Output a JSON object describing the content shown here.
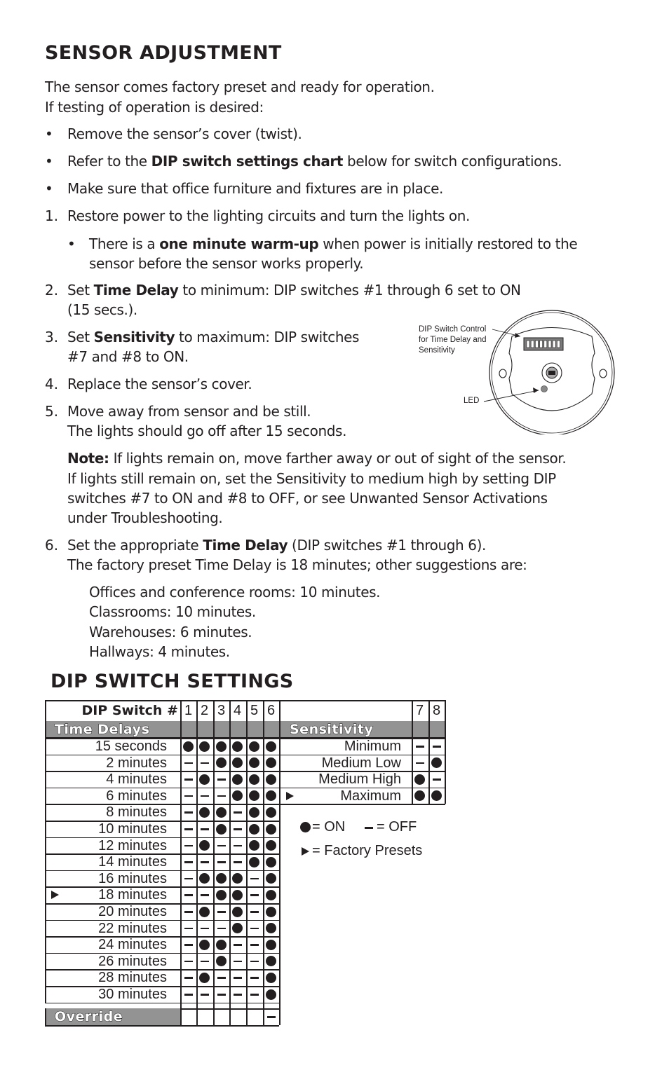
{
  "section1": {
    "title": "SENSOR ADJUSTMENT",
    "intro_line1": "The sensor comes factory preset and ready for operation.",
    "intro_line2": "If testing of operation is desired:",
    "bullets": [
      {
        "pre": "Remove the sensor’s cover (twist).",
        "bold": "",
        "post": ""
      },
      {
        "pre": "Refer to the ",
        "bold": "DIP switch settings chart",
        "post": " below for switch configurations."
      },
      {
        "pre": "Make sure that office furniture and fixtures are in place.",
        "bold": "",
        "post": ""
      }
    ],
    "steps": {
      "s1": {
        "num": "1.",
        "text": "Restore power to the lighting circuits and turn the lights on."
      },
      "s1_sub": {
        "pre": "There is a ",
        "bold": "one minute warm-up",
        "post": " when power is initially restored to the",
        "line2": "sensor before the sensor works properly."
      },
      "s2": {
        "num": "2.",
        "pre": "Set ",
        "bold": "Time Delay",
        "post": " to minimum: DIP switches #1 through 6 set to ON",
        "line2": "(15 secs.)."
      },
      "s3": {
        "num": "3.",
        "pre": "Set ",
        "bold": "Sensitivity",
        "post": " to maximum: DIP switches",
        "line2": "#7 and #8 to ON."
      },
      "s4": {
        "num": "4.",
        "text": "Replace the sensor’s cover."
      },
      "s5": {
        "num": "5.",
        "text": "Move away from sensor and be still.",
        "line2": "The lights should go off after 15 seconds."
      },
      "note": {
        "bold": "Note:",
        "line1": " If lights remain on, move farther away or out of sight of the sensor.",
        "line2": "If lights still remain on, set the Sensitivity to medium high by setting DIP",
        "line3": "switches #7 to ON and #8 to OFF, or see Unwanted Sensor Activations",
        "line4": "under Troubleshooting."
      },
      "s6": {
        "num": "6.",
        "pre": "Set the appropriate ",
        "bold": "Time Delay",
        "post": " (DIP switches #1 through 6).",
        "line2": "The factory preset Time Delay is 18 minutes; other suggestions are:"
      },
      "suggestions": [
        "Offices and conference rooms: 10 minutes.",
        "Classrooms: 10 minutes.",
        "Warehouses: 6 minutes.",
        "Hallways: 4 minutes."
      ]
    },
    "diagram": {
      "dip_label_line1": "DIP Switch Control",
      "dip_label_line2": "for Time Delay and",
      "dip_label_line3": "Sensitivity",
      "led_label": "LED"
    }
  },
  "section2": {
    "title": "DIP SWITCH SETTINGS",
    "header_label": "DIP Switch #",
    "time_columns": [
      "1",
      "2",
      "3",
      "4",
      "5",
      "6"
    ],
    "sens_columns": [
      "7",
      "8"
    ],
    "time_band": "Time Delays",
    "sens_band": "Sensitivity",
    "override_label": "Override",
    "time_rows": [
      {
        "label": "15 seconds",
        "preset": false,
        "switches": [
          1,
          1,
          1,
          1,
          1,
          1
        ]
      },
      {
        "label": "2 minutes",
        "preset": false,
        "switches": [
          0,
          0,
          1,
          1,
          1,
          1
        ]
      },
      {
        "label": "4 minutes",
        "preset": false,
        "switches": [
          0,
          1,
          0,
          1,
          1,
          1
        ]
      },
      {
        "label": "6 minutes",
        "preset": false,
        "switches": [
          0,
          0,
          0,
          1,
          1,
          1
        ]
      },
      {
        "label": "8 minutes",
        "preset": false,
        "switches": [
          0,
          1,
          1,
          0,
          1,
          1
        ]
      },
      {
        "label": "10 minutes",
        "preset": false,
        "switches": [
          0,
          0,
          1,
          0,
          1,
          1
        ]
      },
      {
        "label": "12 minutes",
        "preset": false,
        "switches": [
          0,
          1,
          0,
          0,
          1,
          1
        ]
      },
      {
        "label": "14 minutes",
        "preset": false,
        "switches": [
          0,
          0,
          0,
          0,
          1,
          1
        ]
      },
      {
        "label": "16 minutes",
        "preset": false,
        "switches": [
          0,
          1,
          1,
          1,
          0,
          1
        ]
      },
      {
        "label": "18 minutes",
        "preset": true,
        "switches": [
          0,
          0,
          1,
          1,
          0,
          1
        ]
      },
      {
        "label": "20 minutes",
        "preset": false,
        "switches": [
          0,
          1,
          0,
          1,
          0,
          1
        ]
      },
      {
        "label": "22 minutes",
        "preset": false,
        "switches": [
          0,
          0,
          0,
          1,
          0,
          1
        ]
      },
      {
        "label": "24 minutes",
        "preset": false,
        "switches": [
          0,
          1,
          1,
          0,
          0,
          1
        ]
      },
      {
        "label": "26 minutes",
        "preset": false,
        "switches": [
          0,
          0,
          1,
          0,
          0,
          1
        ]
      },
      {
        "label": "28 minutes",
        "preset": false,
        "switches": [
          0,
          1,
          0,
          0,
          0,
          1
        ]
      },
      {
        "label": "30 minutes",
        "preset": false,
        "switches": [
          0,
          0,
          0,
          0,
          0,
          1
        ]
      }
    ],
    "override_switches": [
      null,
      null,
      null,
      null,
      null,
      0
    ],
    "sens_rows": [
      {
        "label": "Minimum",
        "preset": false,
        "switches": [
          0,
          0
        ]
      },
      {
        "label": "Medium Low",
        "preset": false,
        "switches": [
          0,
          1
        ]
      },
      {
        "label": "Medium High",
        "preset": false,
        "switches": [
          1,
          0
        ]
      },
      {
        "label": "Maximum",
        "preset": true,
        "switches": [
          1,
          1
        ]
      }
    ],
    "legend": {
      "on": "= ON",
      "off": "= OFF",
      "preset": "= Factory Presets"
    }
  }
}
